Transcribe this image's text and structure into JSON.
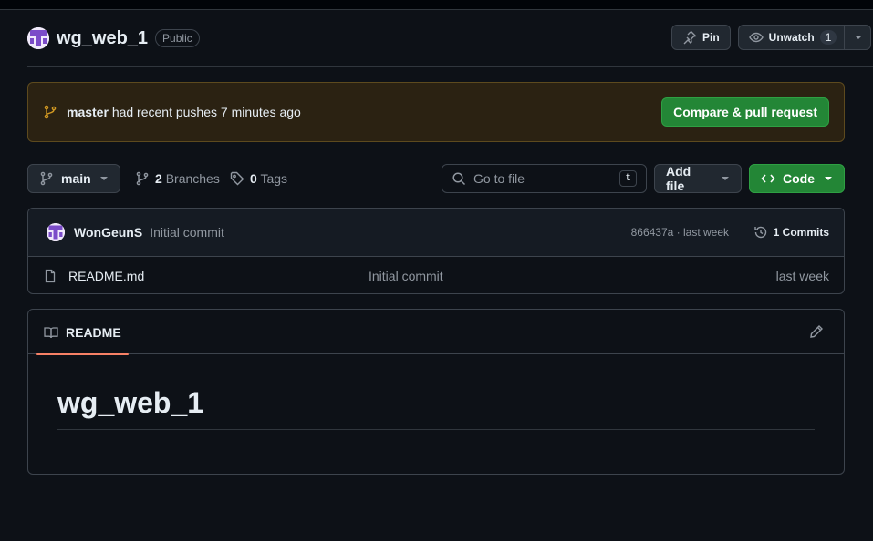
{
  "repo": {
    "name": "wg_web_1",
    "visibility": "Public"
  },
  "header": {
    "pin_label": "Pin",
    "unwatch_label": "Unwatch",
    "watch_count": "1"
  },
  "banner": {
    "branch": "master",
    "message": "had recent pushes 7 minutes ago",
    "button": "Compare & pull request"
  },
  "toolbar": {
    "branch": "main",
    "branches_count": "2",
    "branches_label": "Branches",
    "tags_count": "0",
    "tags_label": "Tags",
    "search_placeholder": "Go to file",
    "search_shortcut": "t",
    "add_file": "Add file",
    "code": "Code"
  },
  "latest_commit": {
    "author": "WonGeunS",
    "message": "Initial commit",
    "meta": "866437a · last week",
    "commits_label": "1 Commits"
  },
  "files": [
    {
      "name": "README.md",
      "commit": "Initial commit",
      "time": "last week"
    }
  ],
  "readme": {
    "tab_label": "README",
    "heading": "wg_web_1"
  },
  "colors": {
    "background": "#0d1117",
    "accent_green": "#238636",
    "banner_bg": "#2b2212",
    "tab_underline": "#f78166",
    "link": "#4493f8"
  }
}
